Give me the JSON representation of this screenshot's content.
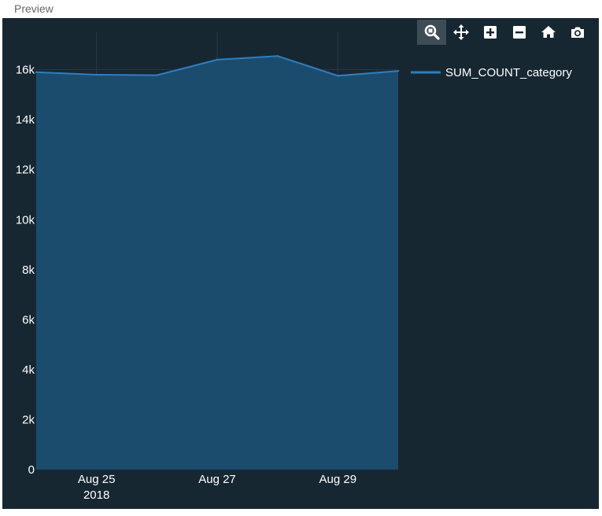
{
  "header": {
    "title": "Preview"
  },
  "modebar": {
    "buttons": [
      {
        "name": "zoom",
        "icon": "zoom-icon",
        "active": true
      },
      {
        "name": "pan",
        "icon": "pan-icon",
        "active": false
      },
      {
        "name": "zoom-in",
        "icon": "zoom-in-icon",
        "active": false
      },
      {
        "name": "zoom-out",
        "icon": "zoom-out-icon",
        "active": false
      },
      {
        "name": "reset-axes",
        "icon": "home-icon",
        "active": false
      },
      {
        "name": "download-png",
        "icon": "camera-icon",
        "active": false
      }
    ]
  },
  "colors": {
    "panel_bg": "#172732",
    "area_fill": "#1b4c6e",
    "line": "#2f7ec0",
    "text": "#ffffff"
  },
  "chart_data": {
    "type": "area",
    "title": "",
    "xlabel": "",
    "ylabel": "",
    "x": [
      "2018-08-24",
      "2018-08-25",
      "2018-08-26",
      "2018-08-27",
      "2018-08-28",
      "2018-08-29",
      "2018-08-30"
    ],
    "series": [
      {
        "name": "SUM_COUNT_category",
        "values": [
          15900,
          15800,
          15780,
          16400,
          16550,
          15760,
          15950
        ]
      }
    ],
    "ylim": [
      0,
      17500
    ],
    "yticks": [
      0,
      2000,
      4000,
      6000,
      8000,
      10000,
      12000,
      14000,
      16000
    ],
    "ytick_labels": [
      "0",
      "2k",
      "4k",
      "6k",
      "8k",
      "10k",
      "12k",
      "14k",
      "16k"
    ],
    "xticks": [
      "2018-08-25",
      "2018-08-27",
      "2018-08-29"
    ],
    "xtick_labels": [
      "Aug 25",
      "Aug 27",
      "Aug 29"
    ],
    "xtick_sublabel": "2018",
    "grid": true,
    "legend": "top-right"
  }
}
